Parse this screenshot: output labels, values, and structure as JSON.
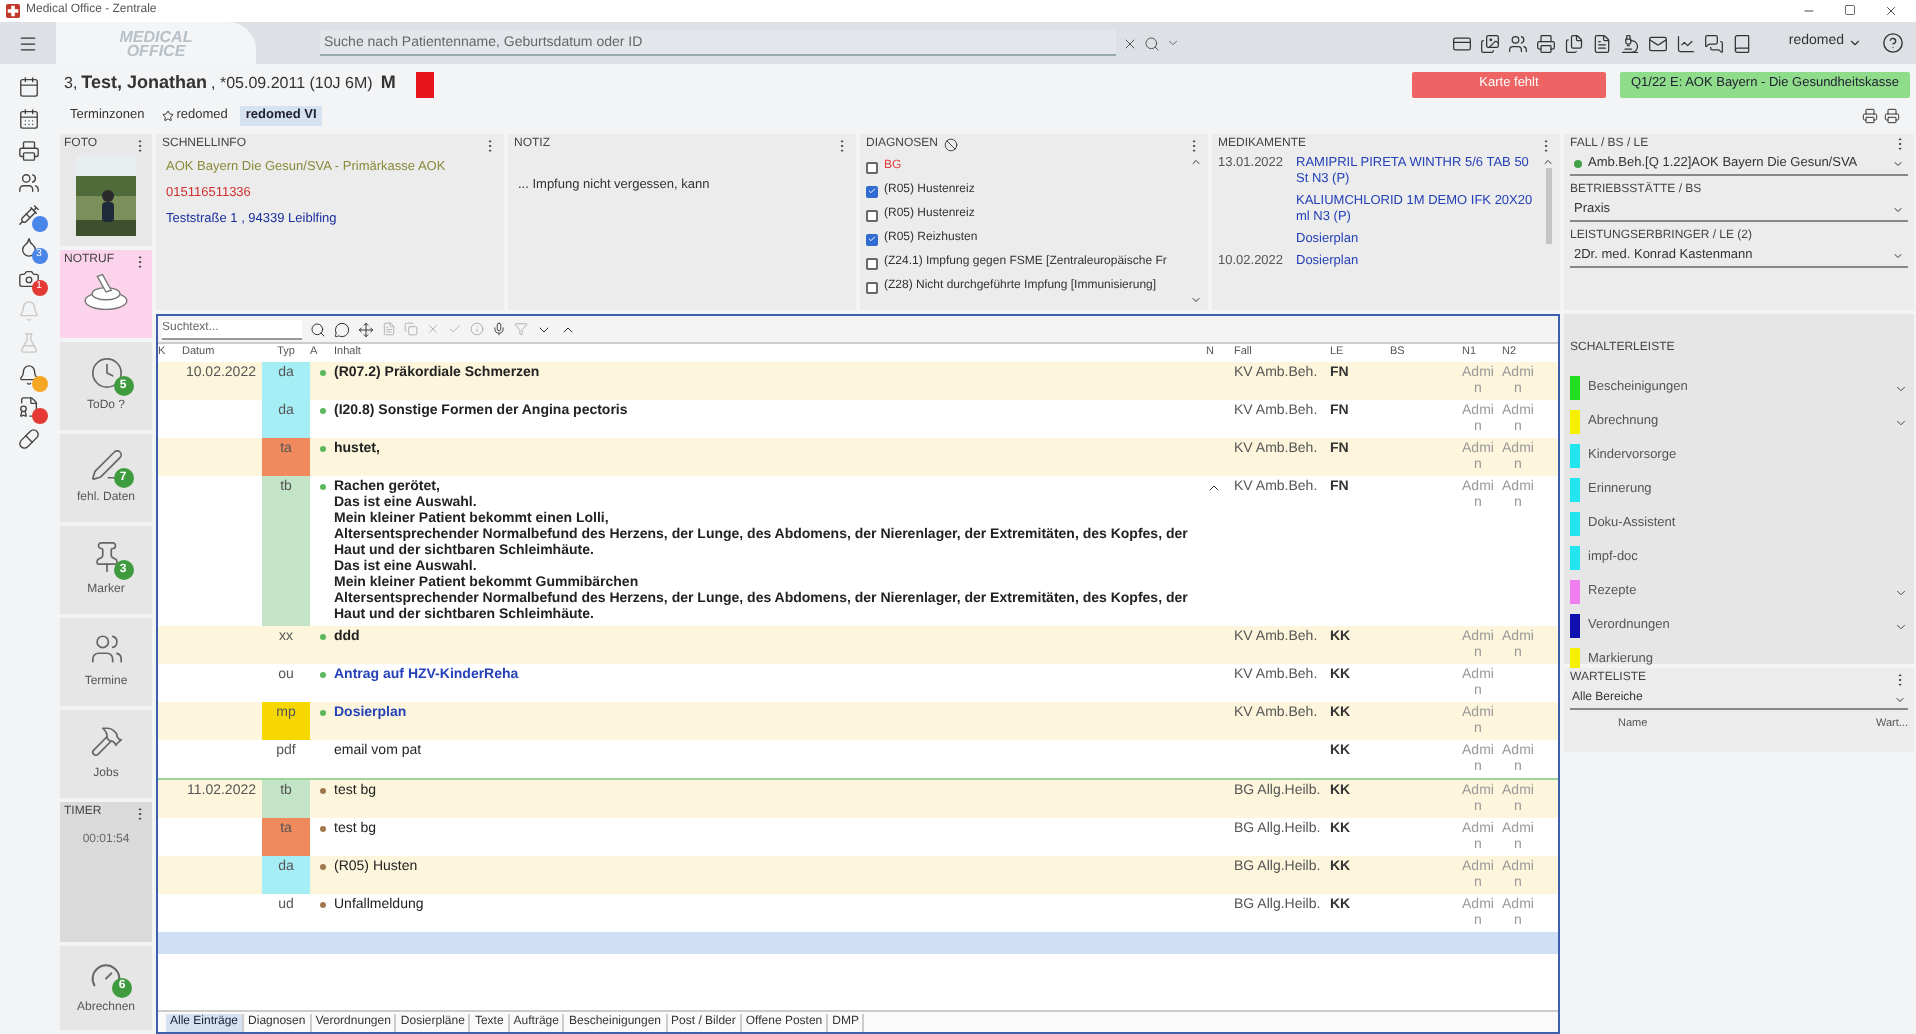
{
  "window": {
    "title": "Medical Office - Zentrale"
  },
  "topbar": {
    "logo_lines": [
      "MEDICAL",
      "OFFICE"
    ],
    "search": {
      "placeholder": "Suche nach Patientenname, Geburtsdatum oder ID"
    },
    "user": "redomed"
  },
  "rail": [
    {
      "disabled": false
    },
    {
      "disabled": false
    },
    {
      "disabled": false
    },
    {
      "disabled": false
    },
    {
      "badge": {
        "color": "#4a86e8"
      },
      "disabled": false
    },
    {
      "badge": {
        "color": "#4a86e8",
        "count": "3"
      },
      "disabled": false
    },
    {
      "badge": {
        "color": "#e53935",
        "count": "1"
      },
      "disabled": false
    },
    {
      "disabled": true
    },
    {
      "disabled": true
    },
    {
      "badge": {
        "color": "#f5a623"
      },
      "disabled": false
    },
    {
      "badge": {
        "color": "#e53935"
      },
      "disabled": false
    },
    {
      "disabled": false
    }
  ],
  "patient": {
    "number": "3,",
    "name": "Test, Jonathan",
    "details": ", *05.09.2011 (10J 6M)",
    "sex": "M",
    "flag": {
      "color": "#e8141e"
    }
  },
  "card_button": "Karte fehlt",
  "insurance_button": "Q1/22 E: AOK Bayern - Die Gesundheitskasse",
  "tabs": [
    {
      "label": "Terminzonen",
      "starred": false,
      "selected": false
    },
    {
      "label": "redomed",
      "starred": true,
      "selected": false
    },
    {
      "label": "redomed VI",
      "starred": false,
      "selected": true
    }
  ],
  "photo": {
    "title": "FOTO"
  },
  "emergency": {
    "title": "NOTRUF"
  },
  "widgets": [
    {
      "label": "ToDo ?",
      "count": "5"
    },
    {
      "label": "fehl. Daten",
      "count": "7"
    },
    {
      "label": "Marker",
      "count": "3"
    },
    {
      "label": "Termine"
    },
    {
      "label": "Jobs"
    }
  ],
  "timer": {
    "title": "TIMER",
    "time": "00:01:54"
  },
  "billing": {
    "label": "Abrechnen",
    "count": "6"
  },
  "quickinfo": {
    "title": "SCHNELLINFO",
    "lines": [
      {
        "text": "AOK Bayern Die Gesun/SVA - Primärkasse AOK",
        "color": "#8a8a3a"
      },
      {
        "text": "015116511336",
        "color": "#d03030"
      },
      {
        "text": "Teststraße 1 , 94339 Leiblfing",
        "color": "#1a2fa0"
      }
    ]
  },
  "note": {
    "title": "NOTIZ",
    "text": "... Impfung nicht vergessen, kann"
  },
  "diagnoses": {
    "title": "DIAGNOSEN",
    "items": [
      {
        "kind": "case",
        "label": "BG",
        "checked": false
      },
      {
        "kind": "diagnosis",
        "label": "(R05) Hustenreiz",
        "checked": true
      },
      {
        "kind": "diagnosis",
        "label": "(R05) Hustenreiz",
        "checked": false
      },
      {
        "kind": "diagnosis",
        "label": "(R05) Reizhusten",
        "checked": true
      },
      {
        "kind": "diagnosis",
        "label": "(Z24.1) Impfung gegen FSME [Zentraleuropäische Fr",
        "checked": false
      },
      {
        "kind": "diagnosis",
        "label": "(Z28) Nicht durchgeführte Impfung [Immunisierung]",
        "checked": false
      }
    ]
  },
  "medications": {
    "title": "MEDIKAMENTE",
    "items": [
      {
        "date": "13.01.2022",
        "name": "RAMIPRIL PIRETA WINTHR 5/6 TAB 50 St N3 (P)"
      },
      {
        "name": "KALIUMCHLORID 1M DEMO IFK 20X20 ml N3 (P)"
      },
      {
        "name": "Dosierplan"
      },
      {
        "date": "10.02.2022",
        "name": "Dosierplan"
      }
    ]
  },
  "case_panel": {
    "fields": [
      {
        "label": "FALL / BS / LE",
        "value": "Amb.Beh.[Q 1.22]AOK Bayern Die Gesun/SVA",
        "dot": {
          "color": "#43a047"
        }
      },
      {
        "label": "BETRIEBSSTÄTTE / BS",
        "value": "Praxis"
      },
      {
        "label": "LEISTUNGSERBRINGER / LE (2)",
        "value": "2Dr. med. Konrad Kastenmann"
      }
    ]
  },
  "journal": {
    "search": {
      "placeholder": "Suchtext..."
    },
    "columns": [
      "K",
      "Datum",
      "Typ",
      "A",
      "Inhalt",
      "N",
      "Fall",
      "LE",
      "BS",
      "N1",
      "N2"
    ],
    "rows": [
      {
        "date": "10.02.2022",
        "type": "da",
        "color": "#a6eef5",
        "kind": "text",
        "bold": true,
        "dot": {
          "color": "#5cb85c"
        },
        "lines": [
          "(R07.2) Präkordiale Schmerzen"
        ],
        "fall": "KV Amb.Beh.",
        "le": "FN",
        "n1": "Admin",
        "n2": "Admin"
      },
      {
        "type": "da",
        "color": "#a6eef5",
        "kind": "text",
        "bold": true,
        "dot": {
          "color": "#5cb85c"
        },
        "lines": [
          "(I20.8) Sonstige Formen der Angina pectoris"
        ],
        "fall": "KV Amb.Beh.",
        "le": "FN",
        "n1": "Admin",
        "n2": "Admin"
      },
      {
        "type": "ta",
        "color": "#f08a5d",
        "kind": "text",
        "bold": true,
        "dot": {
          "color": "#5cb85c"
        },
        "lines": [
          "hustet,"
        ],
        "fall": "KV Amb.Beh.",
        "le": "FN",
        "n1": "Admin",
        "n2": "Admin"
      },
      {
        "type": "tb",
        "color": "#c4e4c8",
        "kind": "text",
        "bold": true,
        "expanded": true,
        "dot": {
          "color": "#5cb85c"
        },
        "lines": [
          "Rachen gerötet,",
          "Das ist eine Auswahl.",
          "Mein kleiner Patient bekommt einen Lolli,",
          "Altersentsprechender Normalbefund des Herzens, der Lunge, des Abdomens, der Nierenlager, der Extremitäten, des Kopfes, der Haut und der sichtbaren Schleimhäute.",
          "Das ist eine Auswahl.",
          "Mein kleiner Patient bekommt Gummibärchen",
          "Altersentsprechender Normalbefund des Herzens, der Lunge, des Abdomens, der Nierenlager, der Extremitäten, des Kopfes, der Haut und der sichtbaren Schleimhäute."
        ],
        "fall": "KV Amb.Beh.",
        "le": "FN",
        "n1": "Admin",
        "n2": "Admin"
      },
      {
        "type": "xx",
        "kind": "text",
        "bold": true,
        "dot": {
          "color": "#5cb85c"
        },
        "lines": [
          "ddd"
        ],
        "fall": "KV Amb.Beh.",
        "le": "KK",
        "n1": "Admin",
        "n2": "Admin"
      },
      {
        "type": "ou",
        "kind": "link",
        "bold": true,
        "dot": {
          "color": "#5cb85c"
        },
        "lines": [
          "Antrag auf HZV-KinderReha"
        ],
        "fall": "KV Amb.Beh.",
        "le": "KK",
        "n1": "Admin"
      },
      {
        "type": "mp",
        "color": "#f7d700",
        "kind": "link",
        "bold": true,
        "dot": {
          "color": "#5cb85c"
        },
        "lines": [
          "Dosierplan"
        ],
        "fall": "KV Amb.Beh.",
        "le": "KK",
        "n1": "Admin"
      },
      {
        "type": "pdf",
        "kind": "text",
        "bold": false,
        "lines": [
          "email vom pat"
        ],
        "le": "KK",
        "n1": "Admin",
        "n2": "Admin"
      },
      {
        "date": "11.02.2022",
        "type": "tb",
        "color": "#c4e4c8",
        "kind": "text",
        "bold": false,
        "dot": {
          "color": "#a07850"
        },
        "lines": [
          "test bg"
        ],
        "fall": "BG Allg.Heilb.",
        "le": "KK",
        "n1": "Admin",
        "n2": "Admin"
      },
      {
        "type": "ta",
        "color": "#f08a5d",
        "kind": "text",
        "bold": false,
        "dot": {
          "color": "#a07850"
        },
        "lines": [
          "test bg"
        ],
        "fall": "BG Allg.Heilb.",
        "le": "KK",
        "n1": "Admin",
        "n2": "Admin"
      },
      {
        "type": "da",
        "color": "#a6eef5",
        "kind": "text",
        "bold": false,
        "dot": {
          "color": "#a07850"
        },
        "lines": [
          "(R05) Husten"
        ],
        "fall": "BG Allg.Heilb.",
        "le": "KK",
        "n1": "Admin",
        "n2": "Admin"
      },
      {
        "type": "ud",
        "kind": "text",
        "bold": false,
        "dot": {
          "color": "#a07850"
        },
        "lines": [
          "Unfallmeldung"
        ],
        "fall": "BG Allg.Heilb.",
        "le": "KK",
        "n1": "Admin",
        "n2": "Admin"
      }
    ],
    "tabs": [
      {
        "label": "Alle Einträge",
        "selected": true
      },
      {
        "label": "Diagnosen",
        "selected": false
      },
      {
        "label": "Verordnungen",
        "selected": false
      },
      {
        "label": "Dosierpläne",
        "selected": false
      },
      {
        "label": "Texte",
        "selected": false
      },
      {
        "label": "Aufträge",
        "selected": false
      },
      {
        "label": "Bescheinigungen",
        "selected": false
      },
      {
        "label": "Post / Bilder",
        "selected": false
      },
      {
        "label": "Offene Posten",
        "selected": false
      },
      {
        "label": "DMP",
        "selected": false
      }
    ]
  },
  "buttonbar": {
    "title": "SCHALTERLEISTE",
    "items": [
      {
        "label": "Bescheinigungen",
        "color": "#22dd22",
        "expandable": true
      },
      {
        "label": "Abrechnung",
        "color": "#f5f000",
        "expandable": true
      },
      {
        "label": "Kindervorsorge",
        "color": "#22e5f0",
        "expandable": false
      },
      {
        "label": "Erinnerung",
        "color": "#22e5f0",
        "expandable": false
      },
      {
        "label": "Doku-Assistent",
        "color": "#22e5f0",
        "expandable": false
      },
      {
        "label": "impf-doc",
        "color": "#22e5f0",
        "expandable": false
      },
      {
        "label": "Rezepte",
        "color": "#f07ef0",
        "expandable": true
      },
      {
        "label": "Verordnungen",
        "color": "#1010b0",
        "expandable": true
      },
      {
        "label": "Markierung",
        "color": "#f5f000",
        "expandable": false
      }
    ]
  },
  "waitlist": {
    "title": "WARTELISTE",
    "filter": "Alle Bereiche",
    "columns": [
      "Name",
      "Wart..."
    ]
  }
}
